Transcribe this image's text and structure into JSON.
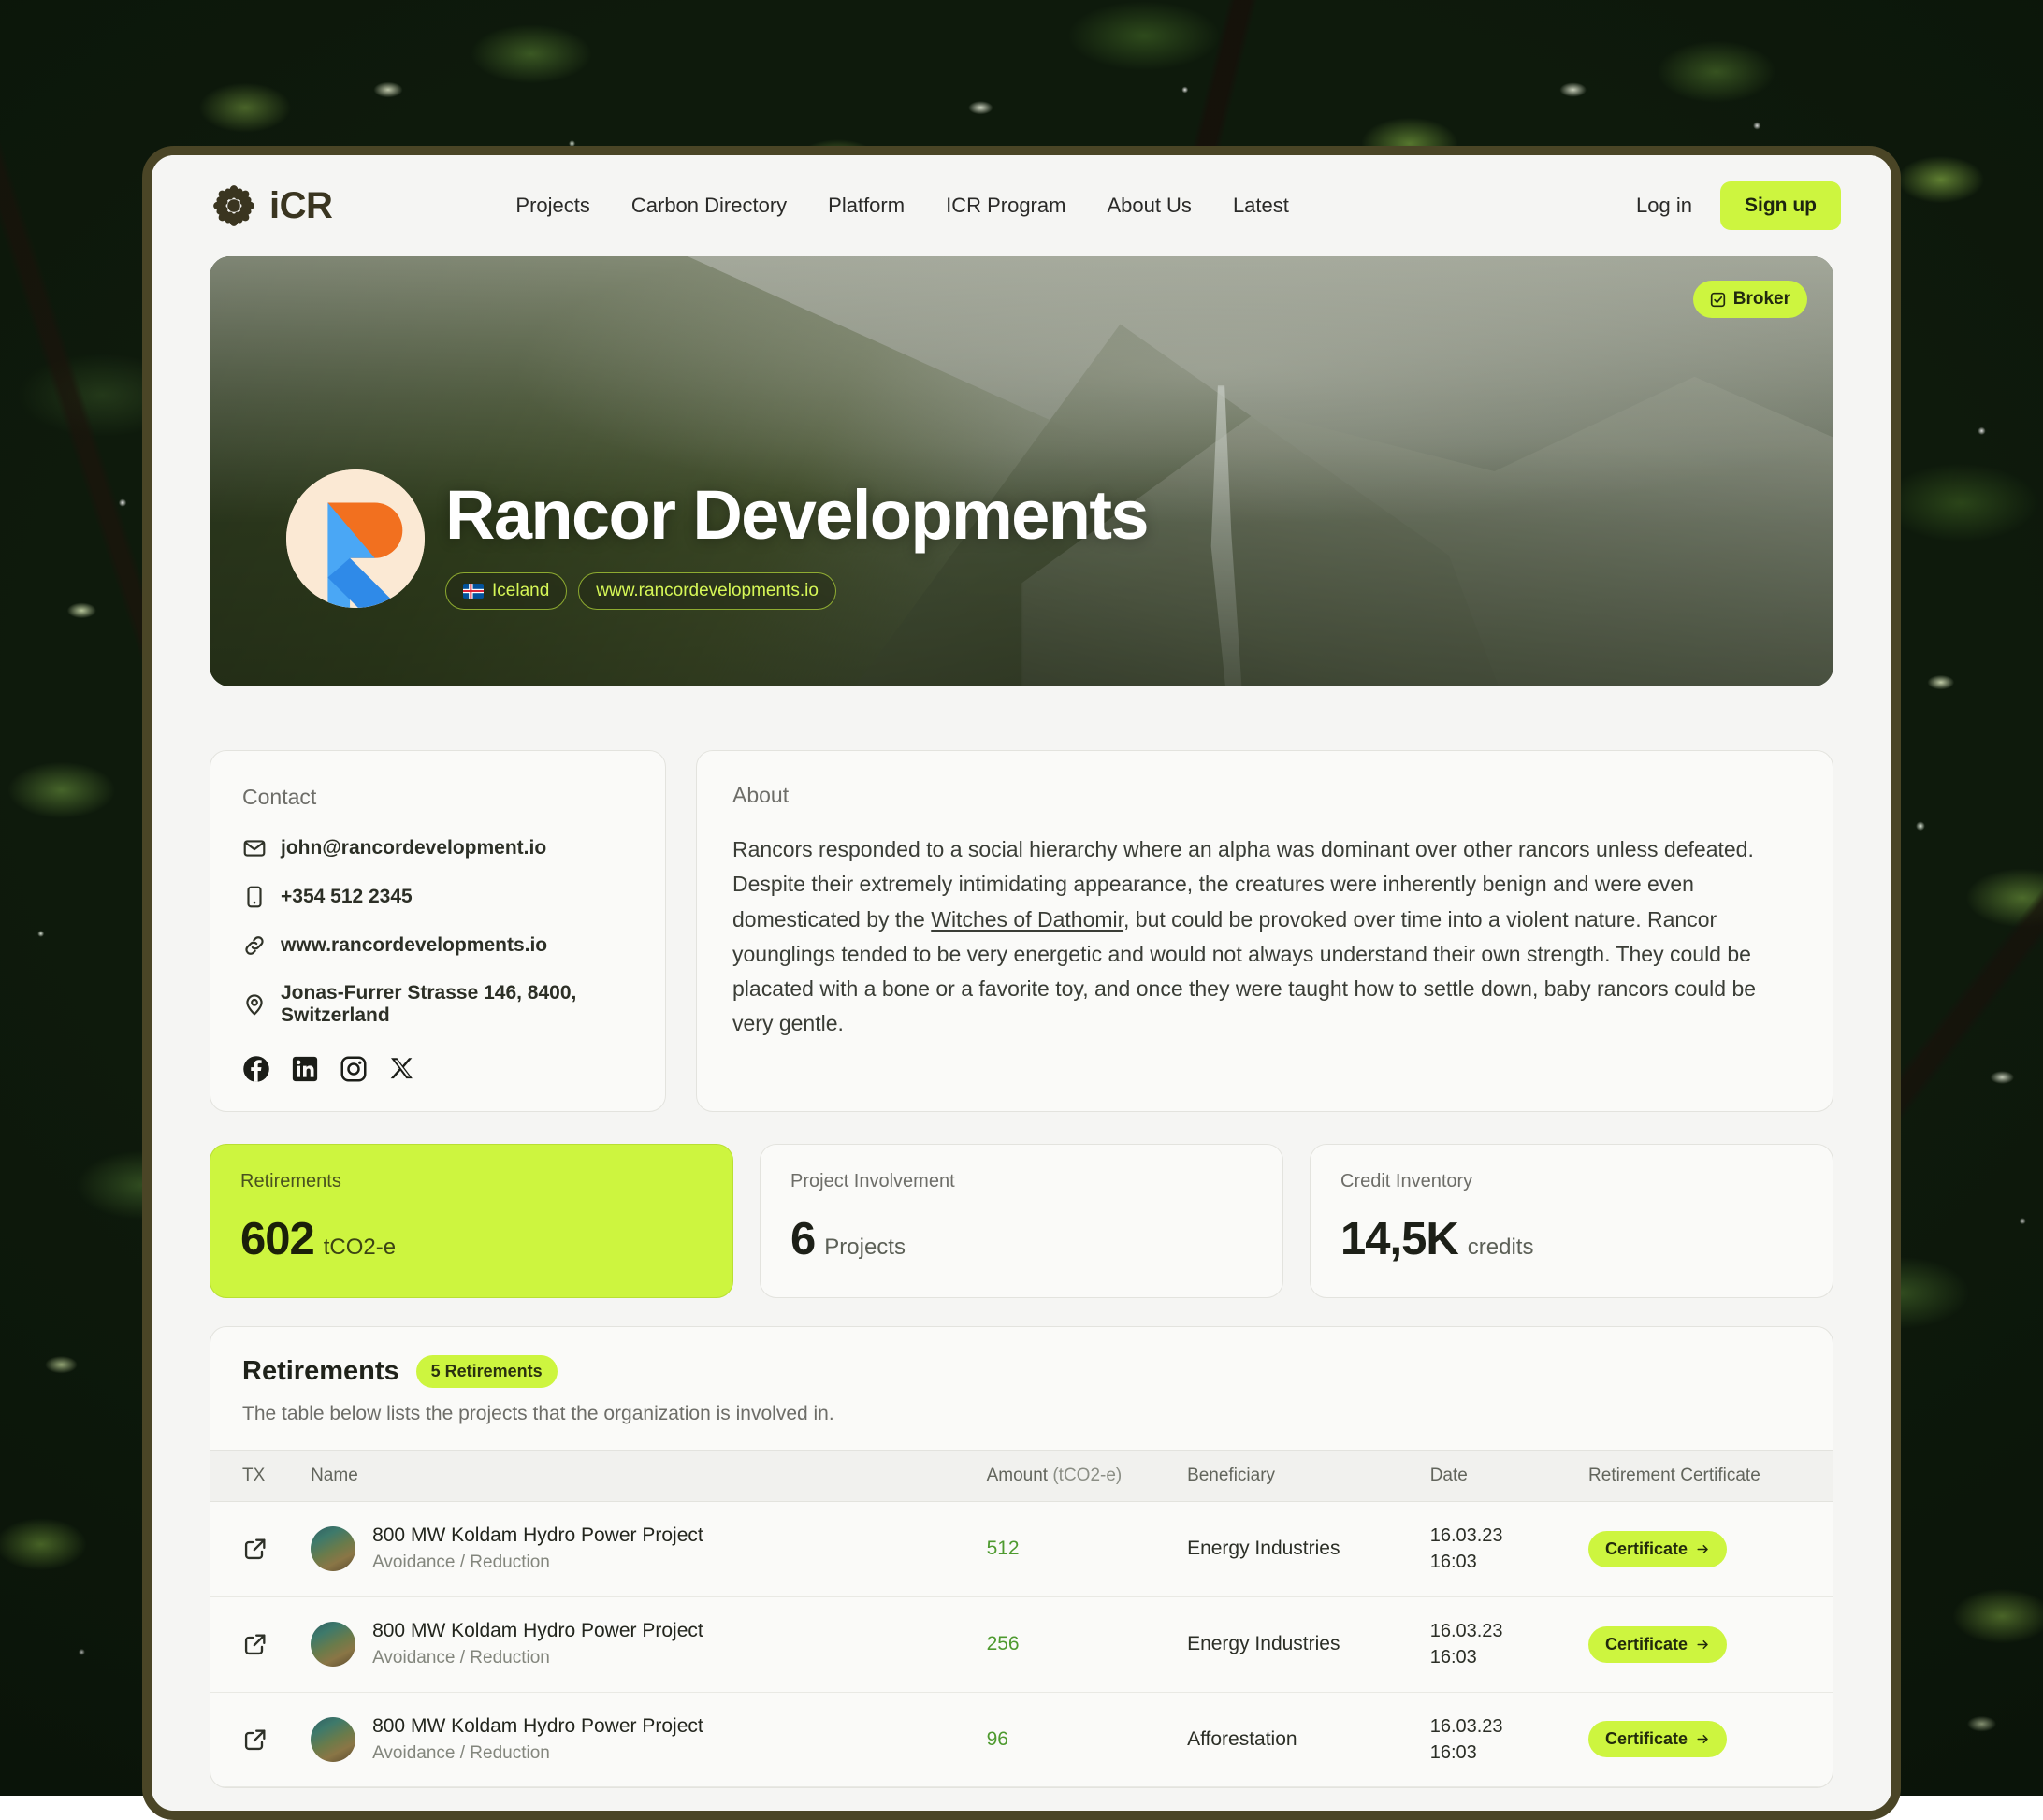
{
  "nav": {
    "brand_text": "iCR",
    "links": [
      {
        "label": "Projects"
      },
      {
        "label": "Carbon Directory"
      },
      {
        "label": "Platform"
      },
      {
        "label": "ICR Program"
      },
      {
        "label": "About Us"
      },
      {
        "label": "Latest"
      }
    ],
    "login_label": "Log in",
    "signup_label": "Sign up"
  },
  "hero": {
    "broker_badge": "Broker",
    "org_name": "Rancor Developments",
    "country": "Iceland",
    "website": "www.rancordevelopments.io"
  },
  "contact": {
    "title": "Contact",
    "email": "john@rancordevelopment.io",
    "phone": "+354 512 2345",
    "website": "www.rancordevelopments.io",
    "address": "Jonas-Furrer Strasse 146, 8400, Switzerland",
    "socials": [
      "facebook-icon",
      "linkedin-icon",
      "instagram-icon",
      "x-icon"
    ]
  },
  "about": {
    "title": "About",
    "part1": "Rancors responded to a social hierarchy where an alpha was dominant over other rancors unless defeated. Despite their extremely intimidating appearance, the creatures were inherently benign and were even domesticated by the ",
    "link": "Witches of Dathomir",
    "part2": ", but could be provoked over time into a violent nature. Rancor younglings tended to be very energetic and would not always understand their own strength. They could be placated with a bone or a favorite toy, and once they were taught how to settle down, baby rancors could be very gentle."
  },
  "stats": [
    {
      "label": "Retirements",
      "value": "602",
      "unit": "tCO2-e",
      "accent": true
    },
    {
      "label": "Project Involvement",
      "value": "6",
      "unit": "Projects",
      "accent": false
    },
    {
      "label": "Credit Inventory",
      "value": "14,5K",
      "unit": "credits",
      "accent": false
    }
  ],
  "table": {
    "title": "Retirements",
    "count_badge": "5 Retirements",
    "subtitle": "The table below lists the projects that the organization is involved in.",
    "columns": {
      "tx": "TX",
      "name": "Name",
      "amount": "Amount",
      "amount_unit": "(tCO2-e)",
      "beneficiary": "Beneficiary",
      "date": "Date",
      "certificate": "Retirement Certificate"
    },
    "cert_label": "Certificate",
    "rows": [
      {
        "name": "800 MW Koldam Hydro Power Project",
        "type": "Avoidance / Reduction",
        "amount": "512",
        "beneficiary": "Energy Industries",
        "date": "16.03.23",
        "time": "16:03"
      },
      {
        "name": "800 MW Koldam Hydro Power Project",
        "type": "Avoidance / Reduction",
        "amount": "256",
        "beneficiary": "Energy Industries",
        "date": "16.03.23",
        "time": "16:03"
      },
      {
        "name": "800 MW Koldam Hydro Power Project",
        "type": "Avoidance / Reduction",
        "amount": "96",
        "beneficiary": "Afforestation",
        "date": "16.03.23",
        "time": "16:03"
      }
    ]
  },
  "colors": {
    "accent_lime": "#CDF53F",
    "amount_green": "#4E9A2F",
    "panel_border": "#4A4526",
    "page_bg": "#F5F5F3"
  }
}
